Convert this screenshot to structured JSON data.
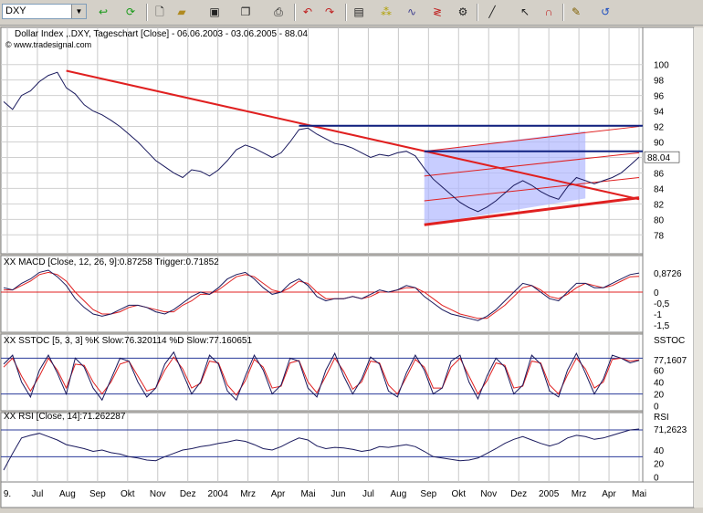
{
  "toolbar": {
    "symbol": "DXY",
    "icons": [
      "green-arrow-icon",
      "refresh-icon",
      "new-document-icon",
      "open-folder-icon",
      "save-icon",
      "copy-icon",
      "print-icon",
      "undo-icon",
      "redo-icon",
      "chart-window-icon",
      "scatter-icon",
      "indicator-icon",
      "zigzag-icon",
      "settings-icon",
      "trendline-icon",
      "cursor-icon",
      "magnet-icon",
      "notes-icon",
      "undo-arrow-icon"
    ]
  },
  "chart_data": [
    {
      "type": "line",
      "title": "Dollar Index ,.DXY, Tageschart [Close] - 06.06.2003 - 03.06.2005 - 88.04",
      "watermark": "© www.tradesignal.com",
      "ylim": [
        76.5,
        101.5
      ],
      "y_ticks": [
        "100",
        "98",
        "96",
        "94",
        "92",
        "90",
        "88",
        "86",
        "84",
        "82",
        "80",
        "78"
      ],
      "last_label": "88.04",
      "series": [
        {
          "values": [
            95.2,
            94.2,
            96.0,
            96.6,
            97.8,
            98.6,
            99.0,
            97.0,
            96.2,
            94.8,
            94.0,
            93.5,
            92.8,
            92.0,
            91.0,
            90.0,
            88.8,
            87.6,
            86.8,
            86.0,
            85.4,
            86.4,
            86.2,
            85.6,
            86.4,
            87.6,
            89.0,
            89.6,
            89.2,
            88.6,
            88.0,
            88.6,
            90.0,
            91.6,
            91.8,
            91.0,
            90.4,
            89.8,
            89.6,
            89.2,
            88.6,
            88.0,
            88.4,
            88.2,
            88.6,
            88.8,
            88.2,
            86.6,
            85.2,
            84.2,
            83.2,
            82.2,
            81.5,
            81.0,
            81.6,
            82.4,
            83.4,
            84.4,
            85.0,
            84.4,
            83.6,
            83.0,
            82.6,
            84.2,
            85.4,
            85.0,
            84.6,
            85.0,
            85.4,
            86.0,
            87.0,
            88.04
          ]
        }
      ]
    },
    {
      "type": "line",
      "title": "XX MACD [Close, 12, 26, 9]:0.87258  Trigger:0.71852",
      "ylim": [
        -1.75,
        1.25
      ],
      "y_ticks": [
        "0,8726",
        "0",
        "-0,5",
        "-1",
        "-1,5"
      ],
      "macd": [
        0.2,
        0.1,
        0.4,
        0.6,
        0.9,
        1.0,
        0.7,
        0.3,
        -0.3,
        -0.7,
        -1.0,
        -1.1,
        -1.0,
        -0.8,
        -0.6,
        -0.6,
        -0.7,
        -0.9,
        -1.0,
        -0.8,
        -0.5,
        -0.2,
        0.0,
        -0.1,
        0.2,
        0.6,
        0.8,
        0.9,
        0.6,
        0.2,
        -0.1,
        0.0,
        0.4,
        0.6,
        0.3,
        -0.2,
        -0.4,
        -0.3,
        -0.3,
        -0.2,
        -0.3,
        -0.1,
        0.1,
        0.0,
        0.1,
        0.3,
        0.2,
        -0.2,
        -0.5,
        -0.8,
        -1.0,
        -1.1,
        -1.2,
        -1.3,
        -1.1,
        -0.8,
        -0.4,
        0.0,
        0.4,
        0.3,
        0.0,
        -0.3,
        -0.4,
        0.0,
        0.4,
        0.4,
        0.2,
        0.2,
        0.4,
        0.6,
        0.8,
        0.87
      ],
      "trigger": [
        0.1,
        0.1,
        0.3,
        0.5,
        0.8,
        0.9,
        0.8,
        0.5,
        0.0,
        -0.4,
        -0.8,
        -1.0,
        -1.0,
        -0.9,
        -0.7,
        -0.6,
        -0.7,
        -0.8,
        -0.9,
        -0.9,
        -0.6,
        -0.4,
        -0.1,
        -0.1,
        0.1,
        0.4,
        0.7,
        0.8,
        0.7,
        0.4,
        0.1,
        0.0,
        0.2,
        0.5,
        0.4,
        0.0,
        -0.3,
        -0.3,
        -0.3,
        -0.2,
        -0.3,
        -0.2,
        0.0,
        0.0,
        0.1,
        0.2,
        0.2,
        0.0,
        -0.3,
        -0.6,
        -0.8,
        -1.0,
        -1.1,
        -1.2,
        -1.2,
        -0.9,
        -0.6,
        -0.2,
        0.2,
        0.3,
        0.1,
        -0.2,
        -0.3,
        -0.1,
        0.2,
        0.4,
        0.3,
        0.2,
        0.3,
        0.5,
        0.7,
        0.72
      ]
    },
    {
      "type": "line",
      "title": "XX SSTOC [5, 3, 3] %K Slow:76.320114  %D Slow:77.160651",
      "ylim": [
        -5,
        105
      ],
      "y_ticks": [
        "SSTOC",
        "77,1607",
        "60",
        "40",
        "20",
        "0"
      ],
      "levels": [
        80,
        20
      ],
      "k_slow": [
        70,
        85,
        40,
        15,
        60,
        85,
        55,
        20,
        80,
        65,
        30,
        10,
        45,
        80,
        75,
        40,
        15,
        30,
        70,
        90,
        55,
        20,
        40,
        85,
        70,
        25,
        10,
        50,
        85,
        60,
        20,
        35,
        80,
        75,
        30,
        15,
        60,
        88,
        50,
        20,
        45,
        82,
        70,
        25,
        15,
        55,
        85,
        60,
        20,
        30,
        75,
        85,
        40,
        12,
        50,
        80,
        65,
        20,
        35,
        85,
        70,
        25,
        15,
        60,
        88,
        55,
        20,
        45,
        85,
        80,
        72,
        76.3
      ],
      "d_slow": [
        65,
        80,
        50,
        25,
        50,
        80,
        60,
        30,
        70,
        68,
        40,
        20,
        40,
        70,
        75,
        50,
        25,
        30,
        60,
        82,
        62,
        30,
        38,
        75,
        72,
        35,
        18,
        42,
        78,
        65,
        30,
        33,
        72,
        76,
        40,
        22,
        50,
        80,
        58,
        28,
        40,
        75,
        72,
        35,
        20,
        48,
        78,
        65,
        30,
        30,
        65,
        80,
        50,
        20,
        42,
        72,
        68,
        30,
        33,
        75,
        72,
        35,
        20,
        52,
        80,
        62,
        30,
        40,
        78,
        80,
        75,
        77.2
      ]
    },
    {
      "type": "line",
      "title": "XX RSI [Close, 14]:71.262287",
      "ylim": [
        -5,
        85
      ],
      "y_ticks": [
        "RSI",
        "71,2623",
        "40",
        "20",
        "0"
      ],
      "levels": [
        70,
        30
      ],
      "values": [
        10,
        35,
        58,
        62,
        65,
        60,
        55,
        48,
        45,
        42,
        38,
        40,
        36,
        34,
        30,
        28,
        25,
        24,
        30,
        35,
        40,
        42,
        45,
        47,
        50,
        52,
        55,
        53,
        48,
        42,
        40,
        45,
        52,
        58,
        55,
        46,
        42,
        44,
        43,
        41,
        38,
        40,
        45,
        44,
        46,
        48,
        45,
        38,
        30,
        28,
        26,
        24,
        25,
        28,
        35,
        42,
        50,
        56,
        60,
        55,
        50,
        46,
        50,
        58,
        62,
        60,
        56,
        58,
        62,
        66,
        70,
        71.3
      ]
    }
  ],
  "x_axis": {
    "labels": [
      "9.",
      "Jul",
      "Aug",
      "Sep",
      "Okt",
      "Nov",
      "Dez",
      "2004",
      "Mrz",
      "Apr",
      "Mai",
      "Jun",
      "Jul",
      "Aug",
      "Sep",
      "Okt",
      "Nov",
      "Dez",
      "2005",
      "Mrz",
      "Apr",
      "Mai"
    ]
  },
  "colors": {
    "price": "#1a1a5e",
    "trendline": "#e02020",
    "level_line": "#102080",
    "channel_fill": "#b0b8ff",
    "macd": "#1a1a5e",
    "trigger": "#e02020",
    "band": "#2a3a9a",
    "zero_line": "#e02020"
  }
}
